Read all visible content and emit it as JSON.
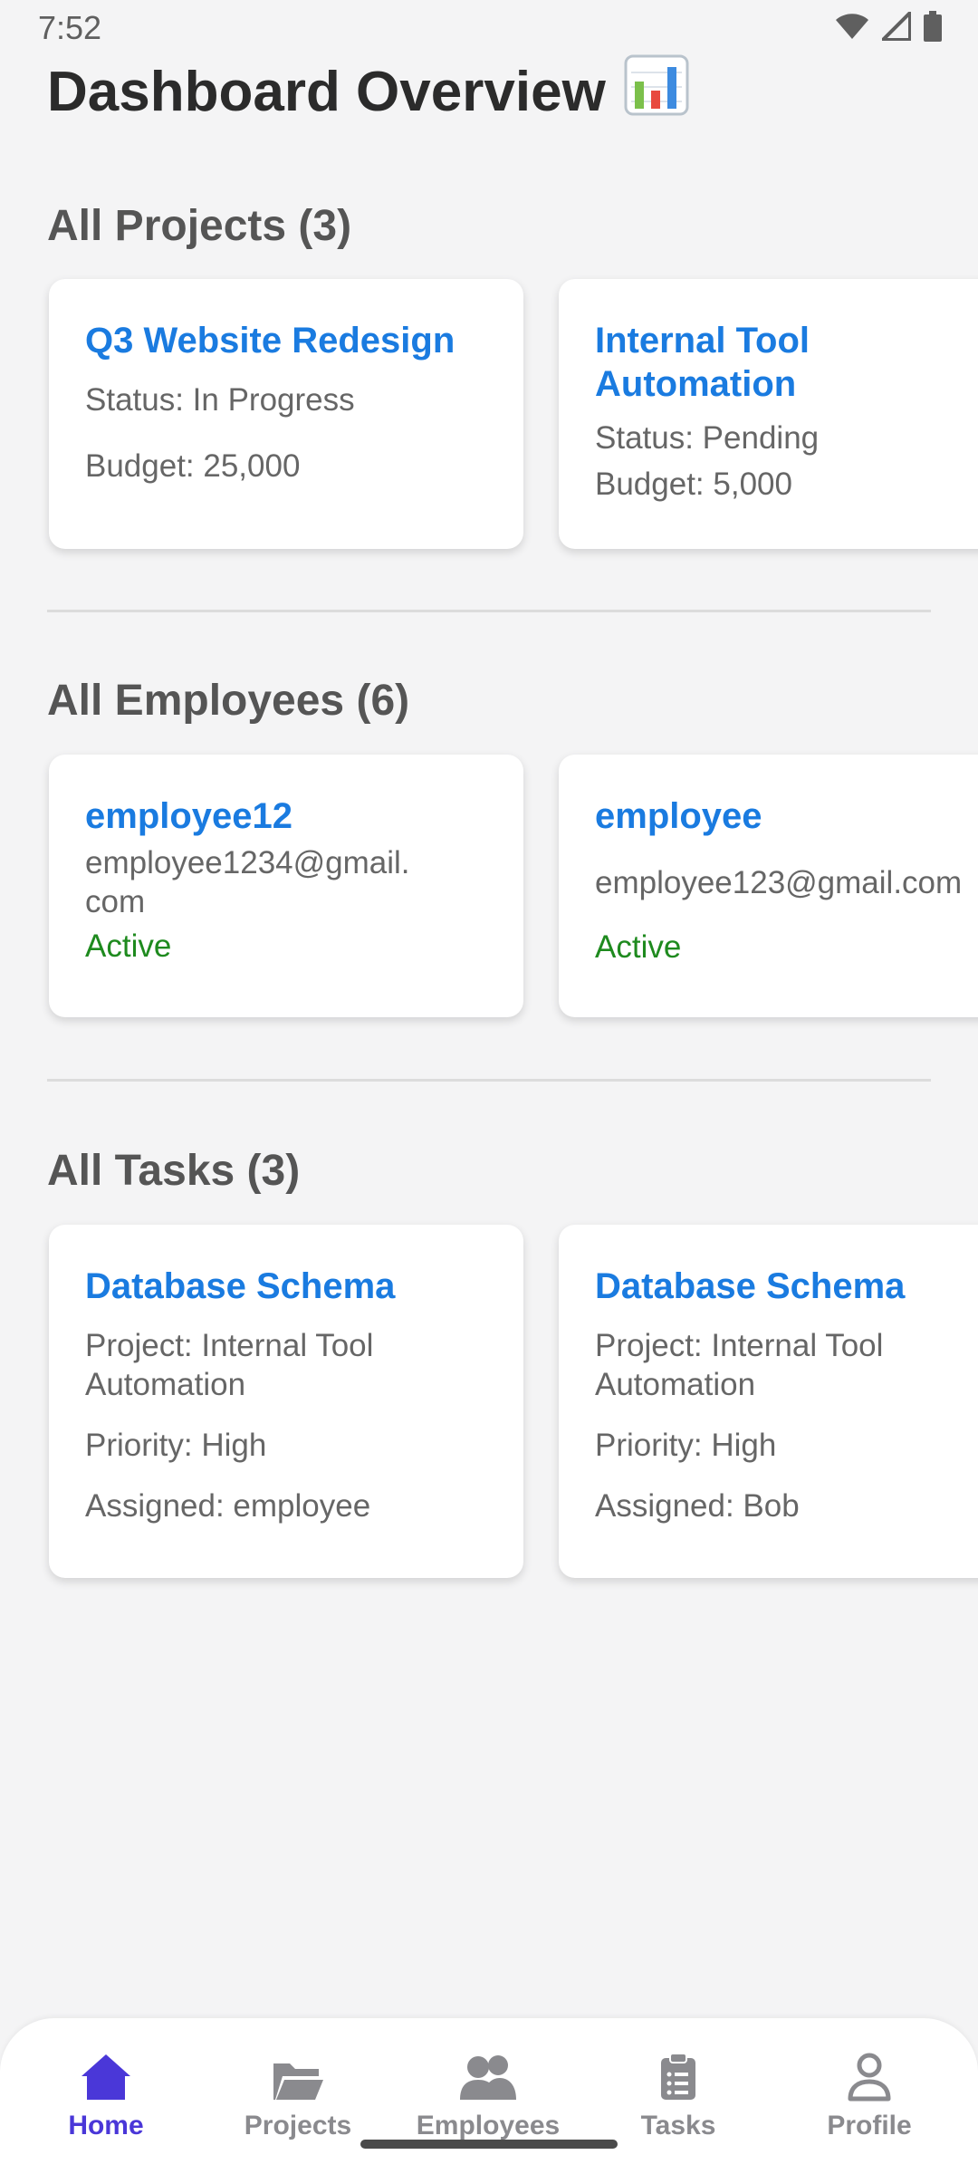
{
  "status_bar": {
    "time": "7:52"
  },
  "header": {
    "title": "Dashboard Overview"
  },
  "projects": {
    "heading": "All Projects (3)",
    "cards": [
      {
        "title": "Q3 Website Redesign",
        "status": "Status: In Progress",
        "budget": "Budget: 25,000"
      },
      {
        "title": "Internal Tool Automation",
        "status": "Status: Pending",
        "budget": "Budget: 5,000"
      }
    ]
  },
  "employees": {
    "heading": "All Employees (6)",
    "cards": [
      {
        "name": "employee12",
        "email": "employee1234@gmail.com",
        "status": "Active"
      },
      {
        "name": "employee",
        "email": "employee123@gmail.com",
        "status": "Active"
      }
    ]
  },
  "tasks": {
    "heading": "All Tasks (3)",
    "cards": [
      {
        "title": "Database Schema",
        "project": "Project: Internal Tool Automation",
        "priority": "Priority: High",
        "assigned": "Assigned: employee"
      },
      {
        "title": "Database Schema",
        "project": "Project: Internal Tool Automation",
        "priority": "Priority: High",
        "assigned": "Assigned: Bob"
      }
    ]
  },
  "bottom_nav": {
    "items": [
      {
        "label": "Home",
        "icon": "home-icon",
        "active": true
      },
      {
        "label": "Projects",
        "icon": "folder-icon",
        "active": false
      },
      {
        "label": "Employees",
        "icon": "people-icon",
        "active": false
      },
      {
        "label": "Tasks",
        "icon": "clipboard-icon",
        "active": false
      },
      {
        "label": "Profile",
        "icon": "person-icon",
        "active": false
      }
    ]
  },
  "colors": {
    "accent_blue": "#1a7be0",
    "active_green": "#1e8a1e",
    "nav_active": "#4a37d8",
    "nav_inactive": "#8a8a8e"
  }
}
